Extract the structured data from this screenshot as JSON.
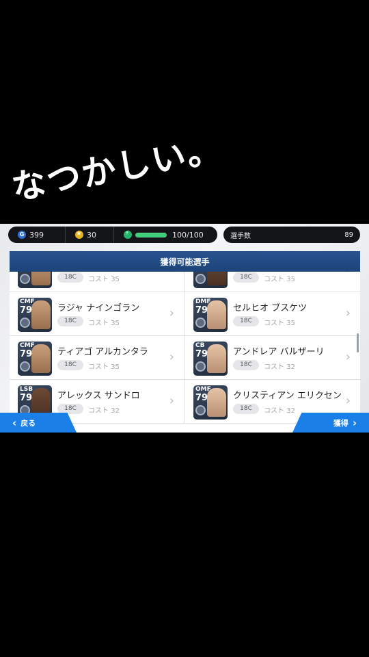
{
  "caption": {
    "text": "なつかしい。"
  },
  "resources": {
    "gp": {
      "value": "399",
      "icon": "gp-coin-icon"
    },
    "coins": {
      "value": "30",
      "icon": "gold-coin-icon"
    },
    "energy": {
      "value": "100/100",
      "fill_fraction": 1.0,
      "icon": "energy-icon"
    }
  },
  "player_count": {
    "label": "選手数",
    "value": "89"
  },
  "list_title": "獲得可能選手",
  "players": [
    {
      "position": "",
      "rating": "",
      "name": "",
      "level": "18C",
      "cost": "コスト 35",
      "skin": "",
      "partial": true
    },
    {
      "position": "",
      "rating": "",
      "name": "",
      "level": "18C",
      "cost": "コスト 35",
      "skin": "dark",
      "partial": true
    },
    {
      "position": "CMF",
      "rating": "79",
      "name": "ラジャ ナインゴラン",
      "level": "18C",
      "cost": "コスト 35",
      "skin": ""
    },
    {
      "position": "DMF",
      "rating": "79",
      "name": "セルヒオ ブスケツ",
      "level": "18C",
      "cost": "コスト 35",
      "skin": "pale"
    },
    {
      "position": "CMF",
      "rating": "79",
      "name": "ティアゴ アルカンタラ",
      "level": "18C",
      "cost": "コスト 35",
      "skin": ""
    },
    {
      "position": "CB",
      "rating": "79",
      "name": "アンドレア バルザーリ",
      "level": "18C",
      "cost": "コスト 32",
      "skin": "pale"
    },
    {
      "position": "LSB",
      "rating": "79",
      "name": "アレックス サンドロ",
      "level": "18C",
      "cost": "コスト 32",
      "skin": "dark"
    },
    {
      "position": "OMF",
      "rating": "79",
      "name": "クリスティアン エリクセン",
      "level": "18C",
      "cost": "コスト 32",
      "skin": "pale"
    }
  ],
  "buttons": {
    "back": "戻る",
    "acquire": "獲得"
  }
}
